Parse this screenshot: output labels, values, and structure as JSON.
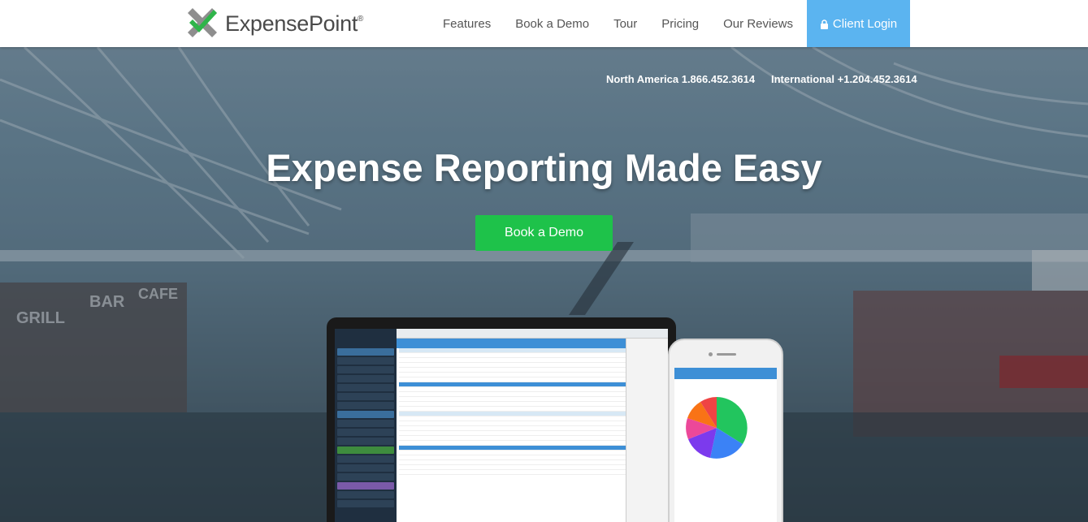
{
  "brand": {
    "name": "ExpensePoint",
    "mark": "®"
  },
  "nav": {
    "links": [
      "Features",
      "Book a Demo",
      "Tour",
      "Pricing",
      "Our Reviews"
    ],
    "login": "Client Login"
  },
  "contact": {
    "north_america": "North America 1.866.452.3614",
    "international": "International +1.204.452.3614"
  },
  "hero": {
    "headline": "Expense Reporting Made Easy",
    "cta": "Book a Demo"
  },
  "icons": [
    "lock-icon",
    "logo-mark-icon"
  ],
  "colors": {
    "login_bg": "#5bb4f0",
    "cta_bg": "#1ec24a",
    "app_blue": "#3d8fd6"
  }
}
